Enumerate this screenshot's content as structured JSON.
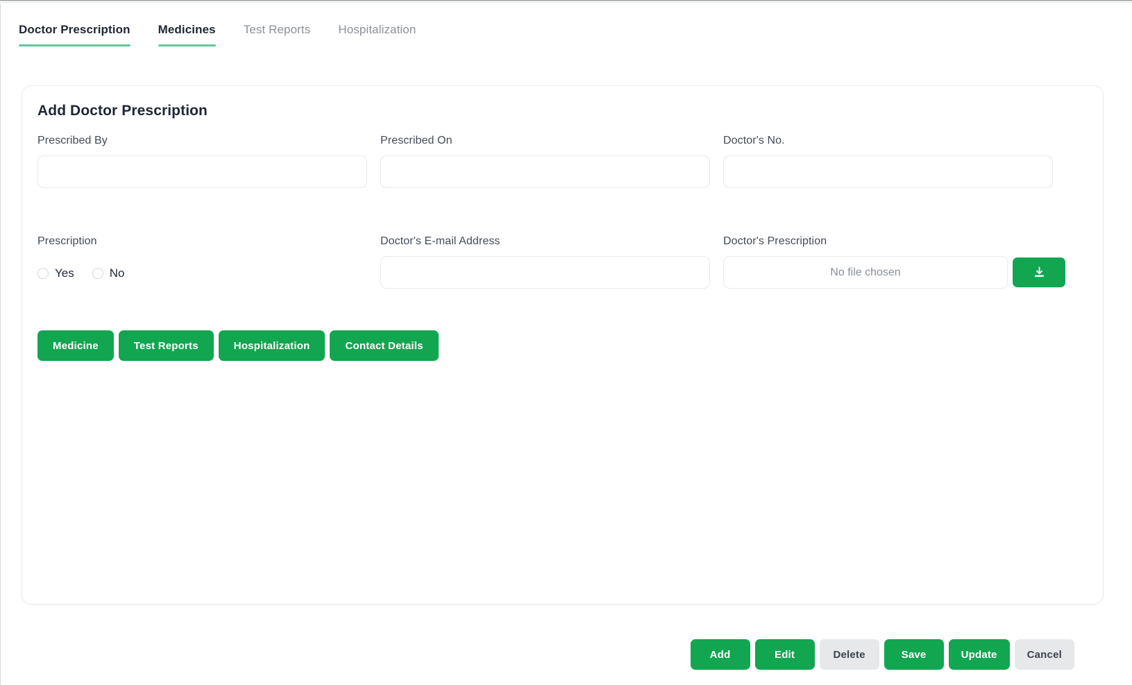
{
  "theme": {
    "green": "#12a651",
    "underline_green": "#63c79a",
    "disabled_gray": "#e6e8ea",
    "text_dark": "#1f2733",
    "text_muted": "#8b9096"
  },
  "tabs": [
    {
      "label": "Doctor Prescription",
      "active": true
    },
    {
      "label": "Medicines",
      "active": true
    },
    {
      "label": "Test Reports",
      "active": false
    },
    {
      "label": "Hospitalization",
      "active": false
    }
  ],
  "card": {
    "title": "Add Doctor Prescription",
    "fields": {
      "prescribed_by": {
        "label": "Prescribed By",
        "value": "",
        "placeholder": ""
      },
      "prescribed_on": {
        "label": "Prescribed On",
        "value": "",
        "placeholder": ""
      },
      "doctors_no": {
        "label": "Doctor's No.",
        "value": "",
        "placeholder": ""
      },
      "prescription": {
        "label": "Prescription",
        "options": [
          {
            "label": "Yes",
            "selected": false
          },
          {
            "label": "No",
            "selected": false
          }
        ]
      },
      "doctors_email": {
        "label": "Doctor's E-mail Address",
        "value": "",
        "placeholder": ""
      },
      "doctors_prescription": {
        "label": "Doctor's Prescription",
        "file_status": "No file chosen",
        "upload_icon": "download-icon"
      }
    },
    "section_buttons": [
      {
        "label": "Medicine"
      },
      {
        "label": "Test Reports"
      },
      {
        "label": "Hospitalization"
      },
      {
        "label": "Contact Details"
      }
    ]
  },
  "footer_actions": [
    {
      "label": "Add",
      "state": "primary"
    },
    {
      "label": "Edit",
      "state": "primary"
    },
    {
      "label": "Delete",
      "state": "disabled"
    },
    {
      "label": "Save",
      "state": "primary"
    },
    {
      "label": "Update",
      "state": "primary"
    },
    {
      "label": "Cancel",
      "state": "disabled"
    }
  ]
}
